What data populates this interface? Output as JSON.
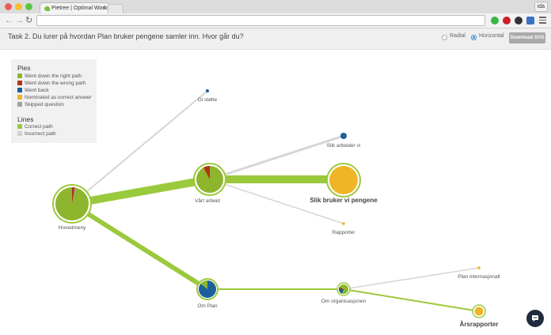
{
  "browser": {
    "tab_title": "Pietree | Optimal Workshop",
    "tab_close": "×",
    "user_badge": "ida",
    "url": "",
    "colors": {
      "close": "#ee5d57",
      "minimize": "#f5bc30",
      "maximize": "#5fc440",
      "extension_green": "#39b54a",
      "extension_pinterest": "#cb2027",
      "extension_dark": "#333333",
      "extension_blue": "#3b73c4"
    },
    "icons": [
      "back-arrow-icon",
      "forward-arrow-icon",
      "reload-icon",
      "hamburger-menu-icon"
    ]
  },
  "page": {
    "task_title": "Task 2. Du lurer på hvordan Plan bruker pengene samler inn. Hvor går du?",
    "layout_options": [
      {
        "label": "Radial",
        "selected": false
      },
      {
        "label": "Horizontal",
        "selected": true
      }
    ],
    "download_label": "Download SVG"
  },
  "legend": {
    "pies_heading": "Pies",
    "lines_heading": "Lines",
    "pie_items": [
      {
        "label": "Went down the right path",
        "color": "#8db52d"
      },
      {
        "label": "Went down the wrong path",
        "color": "#b2340f"
      },
      {
        "label": "Went back",
        "color": "#1d5f9a"
      },
      {
        "label": "Nominated as correct answer",
        "color": "#f0b429"
      },
      {
        "label": "Skipped question",
        "color": "#a0a0a0"
      }
    ],
    "line_items": [
      {
        "label": "Correct path",
        "color": "#9bc93c"
      },
      {
        "label": "Incorrect path",
        "color": "#d2d2d2"
      }
    ]
  },
  "tree": {
    "nodes": [
      {
        "id": "hovedmeny",
        "label": "Hovedmeny",
        "bold": false
      },
      {
        "id": "gi-stotte",
        "label": "Gi støtte",
        "bold": false
      },
      {
        "id": "vart-arbeid",
        "label": "Vårt arbeid",
        "bold": false
      },
      {
        "id": "slik-arbeider-vi",
        "label": "Slik arbeider vi",
        "bold": false
      },
      {
        "id": "slik-bruker-vi-pengene",
        "label": "Slik bruker vi pengene",
        "bold": true
      },
      {
        "id": "rapporter",
        "label": "Rapporter",
        "bold": false
      },
      {
        "id": "om-plan",
        "label": "Om Plan",
        "bold": false
      },
      {
        "id": "om-organisasjonen",
        "label": "Om organisasjonen",
        "bold": false
      },
      {
        "id": "plan-internasjonalt",
        "label": "Plan internasjonalt",
        "bold": false
      },
      {
        "id": "arsrapporter",
        "label": "Årsrapporter",
        "bold": true
      }
    ]
  }
}
